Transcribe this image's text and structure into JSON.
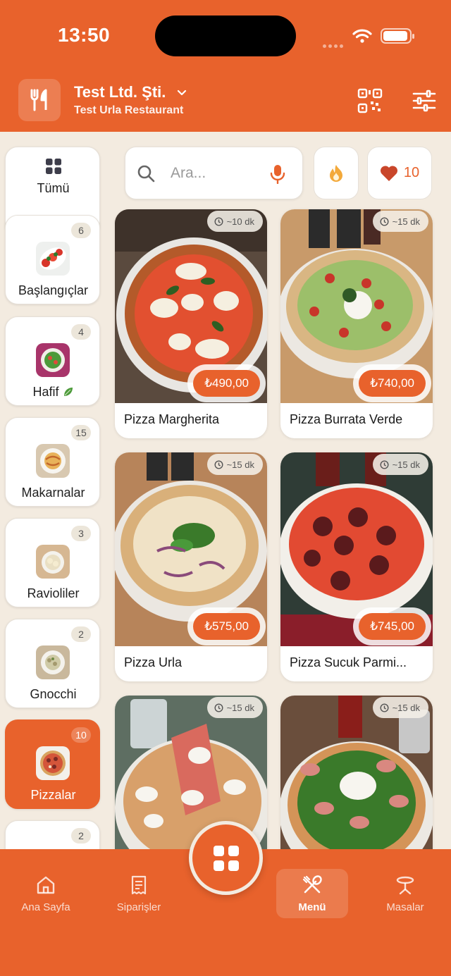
{
  "status": {
    "time": "13:50"
  },
  "header": {
    "company": "Test Ltd. Şti.",
    "restaurant": "Test Urla Restaurant"
  },
  "colors": {
    "accent": "#e8622c",
    "background": "#f3ebe0"
  },
  "categories": [
    {
      "label": "Tümü",
      "count": ""
    },
    {
      "label": "Başlangıçlar",
      "count": "6"
    },
    {
      "label": "Hafif",
      "count": "4",
      "icon": "leaf-icon"
    },
    {
      "label": "Makarnalar",
      "count": "15"
    },
    {
      "label": "Ravioliler",
      "count": "3"
    },
    {
      "label": "Gnocchi",
      "count": "2"
    },
    {
      "label": "Pizzalar",
      "count": "10",
      "active": true
    },
    {
      "label": "",
      "count": "2"
    }
  ],
  "search": {
    "placeholder": "Ara..."
  },
  "favorites": {
    "count": "10"
  },
  "products": [
    {
      "name": "Pizza Margherita",
      "price": "₺490,00",
      "time": "~10 dk"
    },
    {
      "name": "Pizza Burrata Verde",
      "price": "₺740,00",
      "time": "~15 dk"
    },
    {
      "name": "Pizza Urla",
      "price": "₺575,00",
      "time": "~15 dk"
    },
    {
      "name": "Pizza Sucuk Parmi...",
      "price": "₺745,00",
      "time": "~15 dk"
    },
    {
      "name": "",
      "price": "",
      "time": "~15 dk"
    },
    {
      "name": "",
      "price": "",
      "time": "~15 dk"
    }
  ],
  "nav": {
    "home": "Ana Sayfa",
    "orders": "Siparişler",
    "menu": "Menü",
    "tables": "Masalar"
  }
}
